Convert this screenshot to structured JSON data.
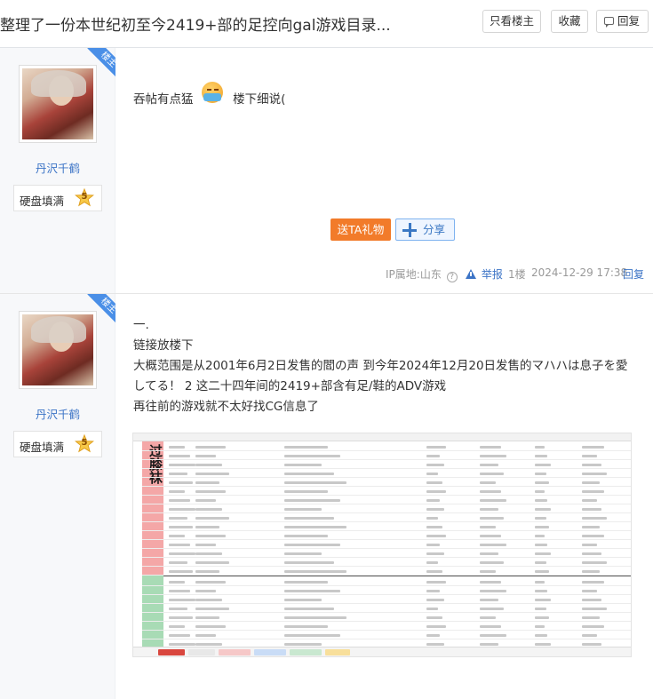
{
  "header": {
    "title": "整理了一份本世纪初至今2419+部的足控向gal游戏目录...",
    "only_op_label": "只看楼主",
    "favorite_label": "收藏",
    "reply_label": "回复"
  },
  "posts": [
    {
      "badge": "楼主",
      "username": "丹沢千鹤",
      "level_title": "硬盘填满",
      "level_num": "5",
      "content": {
        "before_emoji": "吞帖有点猛",
        "after_emoji": "楼下细说("
      },
      "gift_label": "送TA礼物",
      "share_label": "分享",
      "ip_location": "IP属地:山东",
      "report_label": "举报",
      "floor": "1楼",
      "date": "2024-12-29 17:38",
      "reply_label": "回复"
    },
    {
      "badge": "楼主",
      "username": "丹沢千鹤",
      "level_title": "硬盘填满",
      "level_num": "5",
      "lines": [
        "一.",
        "链接放楼下",
        "大概范围是从2001年6月2日发售的閻の声 到今年2024年12月20日发售的マハハは息子を愛",
        "してる！ 2 这二十四年间的2419+部含有足/鞋的ADV游戏",
        "再往前的游戏就不太好找CG信息了"
      ],
      "sheet_label": "过膝袜"
    }
  ],
  "colors": {
    "accent_blue": "#3c74c6",
    "gift_orange": "#f27b2a",
    "ribbon_blue": "#4a8fe7",
    "band_red": "#f4a7a7",
    "band_green": "#a8dbb5"
  },
  "icons": {
    "reply": "reply-bubble-icon",
    "share": "plus-share-icon",
    "report": "warning-icon",
    "ip_help": "question-icon",
    "emoji": "masked-face-emoji",
    "level": "star-badge-icon"
  }
}
